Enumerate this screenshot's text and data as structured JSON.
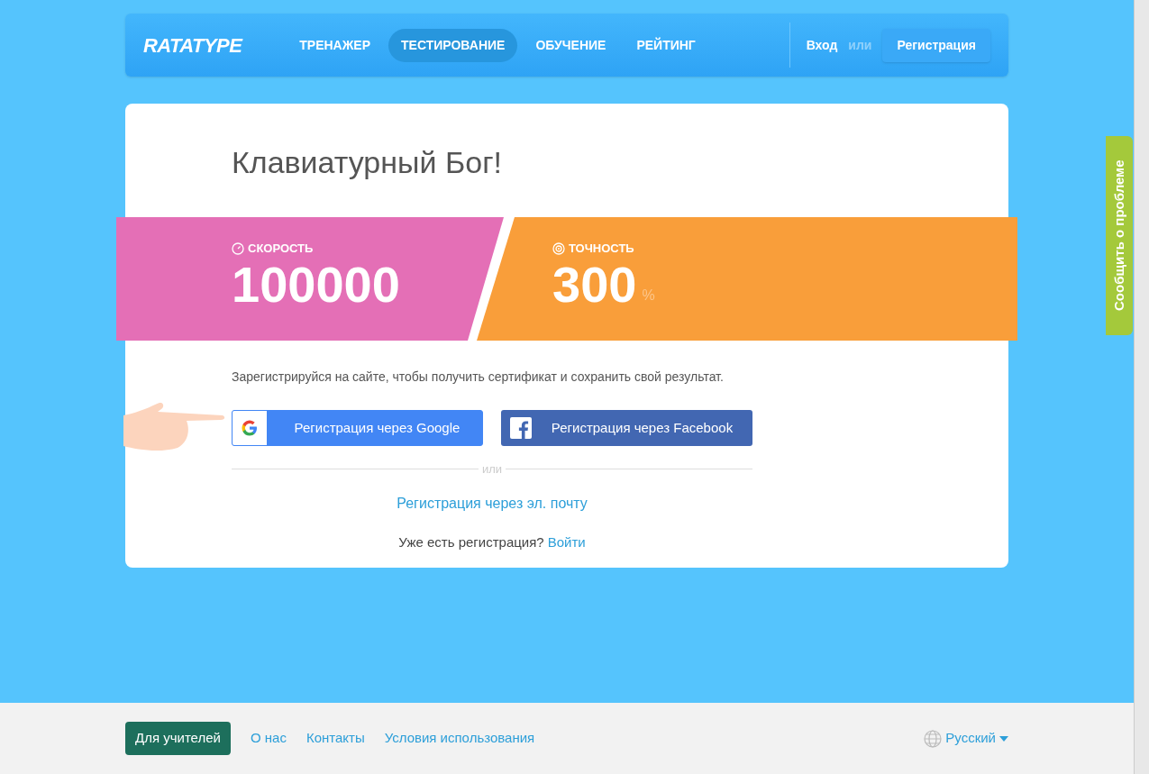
{
  "header": {
    "logo": "RATATYPE",
    "nav": [
      {
        "label": "ТРЕНАЖЕР",
        "selected": false
      },
      {
        "label": "ТЕСТИРОВАНИЕ",
        "selected": true
      },
      {
        "label": "ОБУЧЕНИЕ",
        "selected": false
      },
      {
        "label": "РЕЙТИНГ",
        "selected": false
      }
    ],
    "login": "Вход",
    "or": "или",
    "register": "Регистрация"
  },
  "result": {
    "title": "Клавиатурный Бог!",
    "speed": {
      "label": "СКОРОСТЬ",
      "value": "100000"
    },
    "accuracy": {
      "label": "ТОЧНОСТЬ",
      "value": "300",
      "unit": "%"
    }
  },
  "signup": {
    "text": "Зарегистрируйся на сайте, чтобы получить сертификат и сохранить свой результат.",
    "google": "Регистрация через Google",
    "facebook": "Регистрация через Facebook",
    "or": "или",
    "email": "Регистрация через эл. почту",
    "have_account": "Уже есть регистрация?",
    "login": "Войти"
  },
  "feedback_tab": "Сообщить о проблеме",
  "footer": {
    "teachers": "Для учителей",
    "links": [
      "О нас",
      "Контакты",
      "Условия использования"
    ],
    "language": "Русский"
  }
}
